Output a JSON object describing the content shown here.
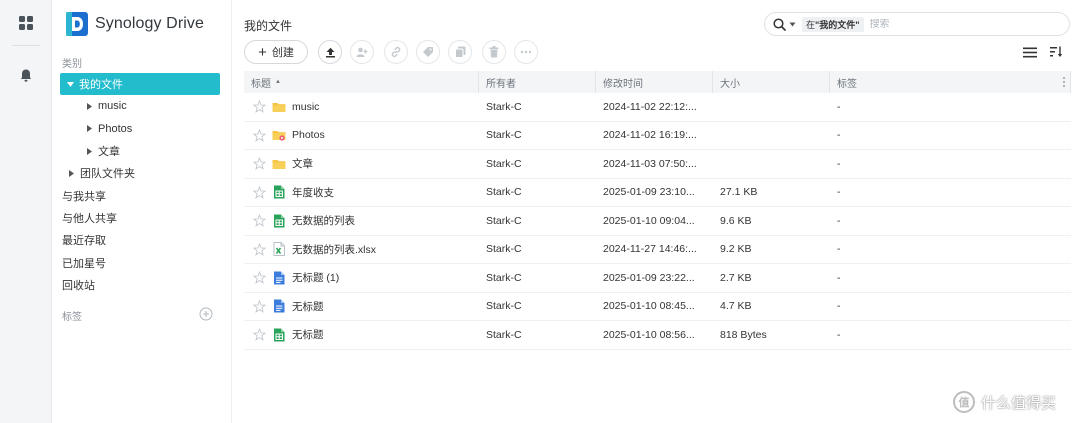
{
  "app": {
    "name": "Synology Drive"
  },
  "rail": {
    "icons": [
      "apps-grid-icon",
      "bell-icon"
    ]
  },
  "sidebar": {
    "section_category": "类别",
    "items": [
      {
        "label": "我的文件",
        "active": true,
        "expanded": true
      },
      {
        "label": "music",
        "child": true
      },
      {
        "label": "Photos",
        "child": true
      },
      {
        "label": "文章",
        "child": true
      },
      {
        "label": "团队文件夹",
        "expandable": true
      },
      {
        "label": "与我共享"
      },
      {
        "label": "与他人共享"
      },
      {
        "label": "最近存取"
      },
      {
        "label": "已加星号"
      },
      {
        "label": "回收站"
      }
    ],
    "section_tags": "标签"
  },
  "main": {
    "title": "我的文件",
    "search": {
      "scope_prefix": "在",
      "scope_name": "\"我的文件\"",
      "placeholder": "搜索"
    },
    "toolbar": {
      "create_label": "创建",
      "tools": [
        "upload-icon",
        "share-user-icon",
        "link-icon",
        "tag-icon",
        "copy-icon",
        "delete-icon",
        "more-icon"
      ]
    },
    "columns": [
      "标题",
      "所有者",
      "修改时间",
      "大小",
      "标签"
    ],
    "sort_indicator": "▲",
    "rows": [
      {
        "name": "music",
        "type": "folder",
        "owner": "Stark-C",
        "mtime": "2024-11-02 22:12:...",
        "size": "",
        "tag": "-"
      },
      {
        "name": "Photos",
        "type": "folder-photo",
        "owner": "Stark-C",
        "mtime": "2024-11-02 16:19:...",
        "size": "",
        "tag": "-"
      },
      {
        "name": "文章",
        "type": "folder",
        "owner": "Stark-C",
        "mtime": "2024-11-03 07:50:...",
        "size": "",
        "tag": "-"
      },
      {
        "name": "年度收支",
        "type": "sheet",
        "owner": "Stark-C",
        "mtime": "2025-01-09 23:10...",
        "size": "27.1 KB",
        "tag": "-"
      },
      {
        "name": "无数据的列表",
        "type": "sheet",
        "owner": "Stark-C",
        "mtime": "2025-01-10 09:04...",
        "size": "9.6 KB",
        "tag": "-"
      },
      {
        "name": "无数据的列表.xlsx",
        "type": "xlsx",
        "owner": "Stark-C",
        "mtime": "2024-11-27 14:46:...",
        "size": "9.2 KB",
        "tag": "-"
      },
      {
        "name": "无标题 (1)",
        "type": "doc",
        "owner": "Stark-C",
        "mtime": "2025-01-09 23:22...",
        "size": "2.7 KB",
        "tag": "-"
      },
      {
        "name": "无标题",
        "type": "doc",
        "owner": "Stark-C",
        "mtime": "2025-01-10 08:45...",
        "size": "4.7 KB",
        "tag": "-"
      },
      {
        "name": "无标题",
        "type": "sheet",
        "owner": "Stark-C",
        "mtime": "2025-01-10 08:56...",
        "size": "818 Bytes",
        "tag": "-"
      }
    ]
  },
  "watermark": {
    "icon_text": "值",
    "text": "什么值得买"
  },
  "colors": {
    "accent": "#22bccc",
    "folder": "#f6c444",
    "sheet": "#2aa35a",
    "doc": "#3b7ddd"
  }
}
